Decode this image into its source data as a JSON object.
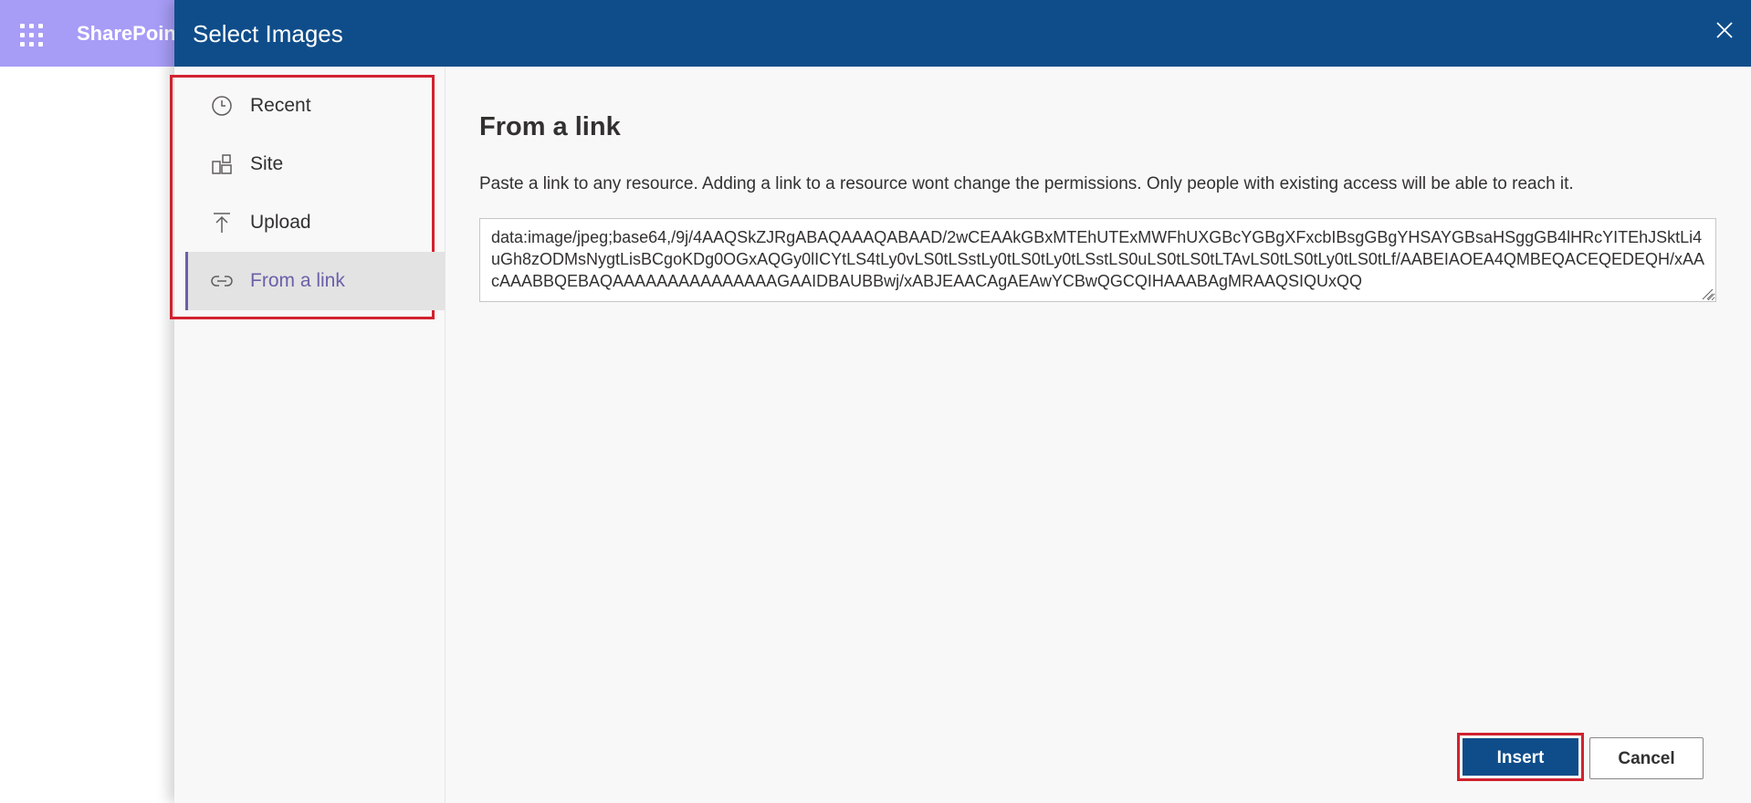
{
  "background_app": {
    "title": "SharePoint",
    "header_color": "#a79cf6",
    "launcher_icon": "waffle-icon"
  },
  "panel": {
    "title": "Select Images",
    "close_icon": "close-icon",
    "header_color": "#0f4d8a"
  },
  "nav": {
    "items": [
      {
        "label": "Recent",
        "icon": "clock-icon",
        "selected": false
      },
      {
        "label": "Site",
        "icon": "site-icon",
        "selected": false
      },
      {
        "label": "Upload",
        "icon": "upload-icon",
        "selected": false
      },
      {
        "label": "From a link",
        "icon": "link-icon",
        "selected": true
      }
    ]
  },
  "content": {
    "title": "From a link",
    "description": "Paste a link to any resource. Adding a link to a resource wont change the permissions. Only people with existing access will be able to reach it.",
    "link_value": "data:image/jpeg;base64,/9j/4AAQSkZJRgABAQAAAQABAAD/2wCEAAkGBxMTEhUTExMWFhUXGBcYGBgXFxcbIBsgGBgYHSAYGBsaHSggGB4lHRcYITEhJSktLi4uGh8zODMsNygtLisBCgoKDg0OGxAQGy0lICYtLS4tLy0vLS0tLSstLy0tLS0tLy0tLSstLS0uLS0tLS0tLTAvLS0tLS0tLy0tLS0tLf/AABEIAOEA4QMBEQACEQEDEQH/xAAcAAABBQEBAQAAAAAAAAAAAAAAAGAAIDBAUBBwj/xABJEAACAgAEAwYCBwQGCQIHAAABAgMRAAQSIQUxQQ"
  },
  "footer": {
    "insert_label": "Insert",
    "cancel_label": "Cancel",
    "primary_color": "#0f4d8a",
    "highlight_color": "#d1222f"
  }
}
